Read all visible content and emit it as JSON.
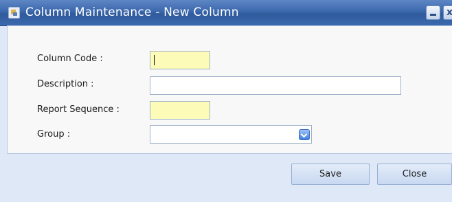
{
  "window": {
    "title_prefix": "Column Maintenance",
    "title_sep": " - ",
    "title_suffix": "New Column",
    "close_glyph": "x"
  },
  "form": {
    "column_code": {
      "label": "Column Code :",
      "value": "",
      "required": true
    },
    "description": {
      "label": "Description :",
      "value": ""
    },
    "report_sequence": {
      "label": "Report Sequence :",
      "value": "",
      "required": true
    },
    "group": {
      "label": "Group :",
      "value": ""
    }
  },
  "buttons": {
    "save": "Save",
    "close": "Close"
  },
  "icons": {
    "app": "form-icon",
    "minimize": "minimize-icon",
    "close": "close-icon",
    "dropdown": "chevron-down-icon"
  },
  "colors": {
    "titlebar": "#3b68ad",
    "required_field": "#fdfbb8",
    "panel": "#f8f8f9",
    "background": "#dfe8f6"
  }
}
